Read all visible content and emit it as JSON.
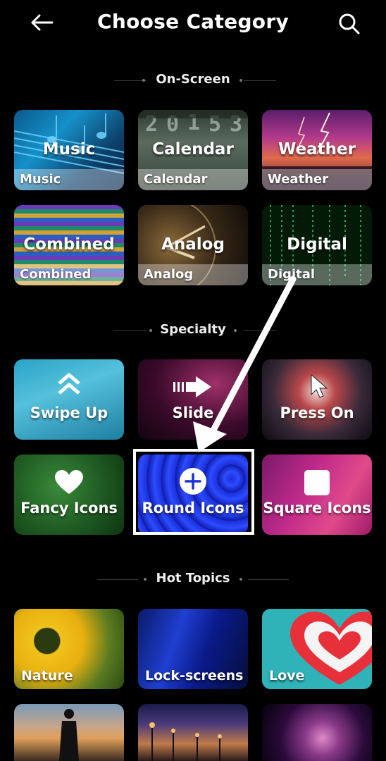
{
  "header": {
    "title": "Choose Category",
    "back_icon": "arrow-left-icon",
    "search_icon": "search-icon"
  },
  "sections": [
    {
      "label": "On-Screen"
    },
    {
      "label": "Specialty"
    },
    {
      "label": "Hot Topics"
    }
  ],
  "onscreen": [
    {
      "big": "Music",
      "caption": "Music"
    },
    {
      "big": "Calendar",
      "caption": "Calendar"
    },
    {
      "big": "Weather",
      "caption": "Weather"
    },
    {
      "big": "Combined",
      "caption": "Combined"
    },
    {
      "big": "Analog",
      "caption": "Analog"
    },
    {
      "big": "Digital",
      "caption": "Digital"
    }
  ],
  "specialty": [
    {
      "label": "Swipe Up",
      "icon": "chevron-up-icon"
    },
    {
      "label": "Slide",
      "icon": "arrow-right-icon"
    },
    {
      "label": "Press On",
      "icon": "cursor-icon"
    },
    {
      "label": "Fancy Icons",
      "icon": "heart-icon"
    },
    {
      "label": "Round Icons",
      "icon": "plus-circle-icon"
    },
    {
      "label": "Square Icons",
      "icon": "square-icon"
    }
  ],
  "hot_topics": [
    {
      "label": "Nature"
    },
    {
      "label": "Lock-screens"
    },
    {
      "label": "Love"
    }
  ],
  "colors": {
    "background": "#000000",
    "highlight_border": "#ffffff"
  }
}
